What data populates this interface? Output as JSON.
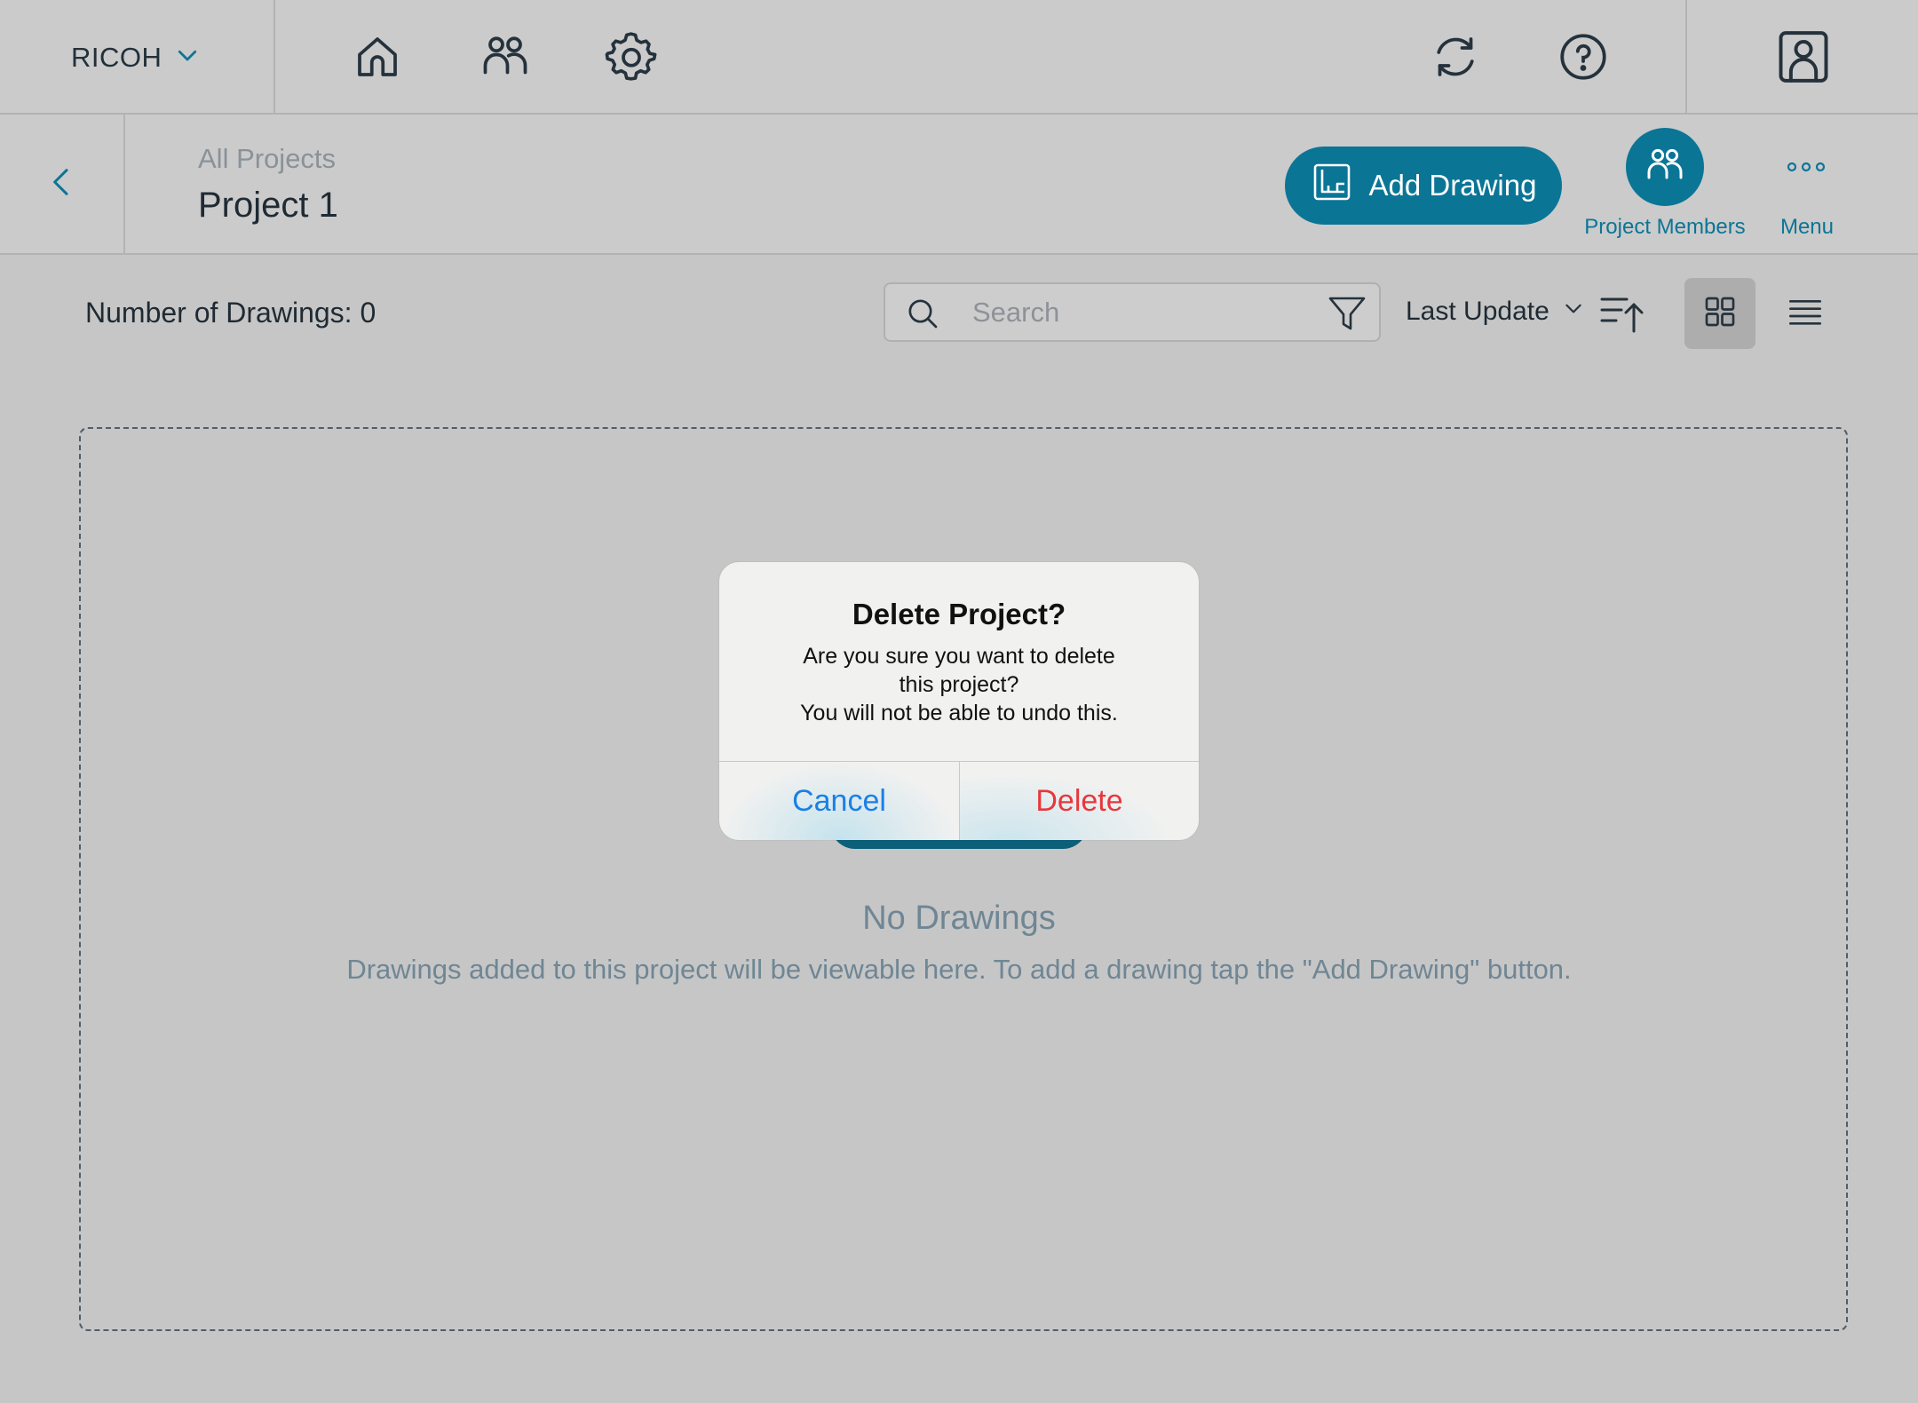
{
  "topbar": {
    "org_name": "RICOH",
    "icons": [
      "chevron-down-icon",
      "home-icon",
      "users-icon",
      "gear-icon",
      "sync-icon",
      "help-icon",
      "account-icon"
    ]
  },
  "project_header": {
    "breadcrumb": "All Projects",
    "title": "Project 1",
    "add_drawing_label": "Add Drawing",
    "members_label": "Project Members",
    "menu_label": "Menu"
  },
  "toolbar": {
    "count_label": "Number of Drawings: 0",
    "search_placeholder": "Search",
    "sort_label": "Last Update",
    "view_mode": "grid"
  },
  "empty_state": {
    "title": "No Drawings",
    "description": "Drawings added to this project will be viewable here. To add a drawing tap the \"Add Drawing\" button."
  },
  "dialog": {
    "title": "Delete Project?",
    "message_lines": [
      "Are you sure you want to delete",
      "this project?",
      "You will not be able to undo this."
    ],
    "cancel_label": "Cancel",
    "delete_label": "Delete"
  },
  "colors": {
    "accent": "#0b7596",
    "destructive": "#e8373b",
    "ios_blue": "#1a7fe6",
    "background": "#c6c6c6"
  }
}
